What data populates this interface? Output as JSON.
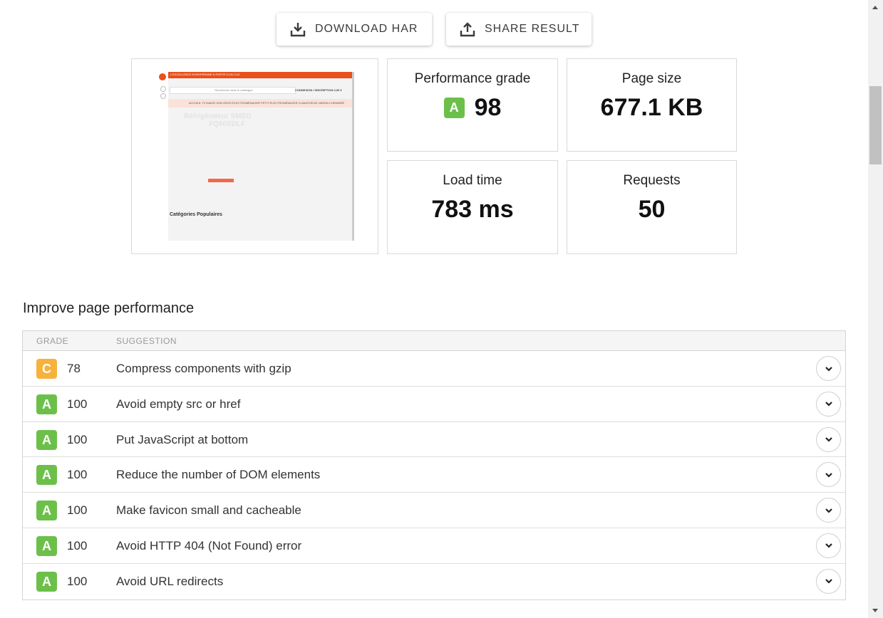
{
  "toolbar": {
    "download_label": "DOWNLOAD HAR",
    "share_label": "SHARE RESULT"
  },
  "thumbnail": {
    "topbar_text": "L'EXCELLENCE EUROPÉENNE À PORTÉ D'UN CLIC",
    "search_placeholder": "Rechercher dans le catalogue",
    "login_text": "CONNEXION / INSCRIPTION",
    "cart_text": "0,00 €",
    "nav_text": "ACCUEIL   TV IMAGE SON   GROS ÉLECTROMÉNAGER   PETIT ÉLECTROMÉNAGER   CLIMATISEUR   JARDIN   CHEMINÉE",
    "hero_line1": "Réfrigérateur SMEG",
    "hero_line2": "FQ60XDLF",
    "category_title": "Catégories Populaires"
  },
  "metrics": {
    "performance": {
      "label": "Performance grade",
      "grade": "A",
      "value": "98"
    },
    "page_size": {
      "label": "Page size",
      "value": "677.1 KB"
    },
    "load_time": {
      "label": "Load time",
      "value": "783 ms"
    },
    "requests": {
      "label": "Requests",
      "value": "50"
    }
  },
  "section": {
    "title": "Improve page performance"
  },
  "table": {
    "headers": {
      "grade": "GRADE",
      "suggestion": "SUGGESTION"
    },
    "rows": [
      {
        "grade": "C",
        "score": "78",
        "suggestion": "Compress components with gzip",
        "color": "#f7b23b"
      },
      {
        "grade": "A",
        "score": "100",
        "suggestion": "Avoid empty src or href",
        "color": "#6cc04a"
      },
      {
        "grade": "A",
        "score": "100",
        "suggestion": "Put JavaScript at bottom",
        "color": "#6cc04a"
      },
      {
        "grade": "A",
        "score": "100",
        "suggestion": "Reduce the number of DOM elements",
        "color": "#6cc04a"
      },
      {
        "grade": "A",
        "score": "100",
        "suggestion": "Make favicon small and cacheable",
        "color": "#6cc04a"
      },
      {
        "grade": "A",
        "score": "100",
        "suggestion": "Avoid HTTP 404 (Not Found) error",
        "color": "#6cc04a"
      },
      {
        "grade": "A",
        "score": "100",
        "suggestion": "Avoid URL redirects",
        "color": "#6cc04a"
      }
    ]
  },
  "colors": {
    "grade_a": "#6cc04a",
    "grade_c": "#f7b23b"
  }
}
